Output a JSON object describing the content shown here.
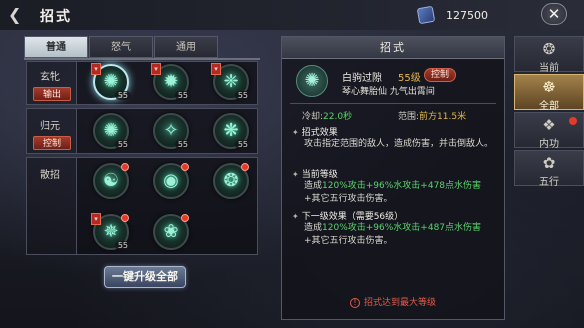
{
  "header": {
    "title": "招式",
    "back_icon": "back-arrow-icon",
    "currency_icon": "book-currency-icon",
    "currency_value": "127500",
    "close_icon": "close-icon"
  },
  "tabs": [
    {
      "label": "普通",
      "active": true
    },
    {
      "label": "怒气",
      "active": false
    },
    {
      "label": "通用",
      "active": false
    }
  ],
  "rows": [
    {
      "label": "玄牝",
      "badge": "输出",
      "skills": [
        {
          "glyph": "✺",
          "level": "55",
          "tagged": true,
          "selected": true
        },
        {
          "glyph": "✹",
          "level": "55",
          "tagged": true
        },
        {
          "glyph": "❈",
          "level": "55",
          "tagged": true
        }
      ]
    },
    {
      "label": "归元",
      "badge": "控制",
      "skills": [
        {
          "glyph": "✺",
          "level": "55"
        },
        {
          "glyph": "✧",
          "level": "55"
        },
        {
          "glyph": "❋",
          "level": "55"
        }
      ]
    },
    {
      "label": "散招",
      "badge": "",
      "skills": [
        {
          "glyph": "☯",
          "dot": true
        },
        {
          "glyph": "◉",
          "dot": true
        },
        {
          "glyph": "❂",
          "dot": true
        },
        {
          "glyph": "✵",
          "level": "55",
          "tagged": true,
          "dot": true
        },
        {
          "glyph": "❀",
          "dot": true
        }
      ]
    }
  ],
  "upgrade_button": "一键升级全部",
  "detail": {
    "header": "招式",
    "icon": "skill-wind-icon",
    "name": "白驹过隙",
    "level": "55级",
    "type": "控制",
    "desc": "琴心舞胎仙 九气出霄间",
    "cd_label": "冷却:",
    "cd_value": "22.0秒",
    "range_label": "范围:",
    "range_value": "前方11.5米",
    "effect_title": "招式效果",
    "effect_text": "攻击指定范围的敌人，造成伤害，并击倒敌人。",
    "cur_title": "当前等级",
    "cur_prefix": "造成",
    "cur_a": "120%攻击",
    "cur_b": "+96%水攻击",
    "cur_c": "+478点水伤害",
    "cur_suffix": "+其它五行攻击伤害。",
    "next_title": "下一级效果（需要56级）",
    "next_prefix": "造成",
    "next_a": "120%攻击",
    "next_b": "+96%水攻击",
    "next_c": "+487点水伤害",
    "next_suffix": "+其它五行攻击伤害。",
    "footer": "招式达到最大等级"
  },
  "sidenav": [
    {
      "label": "当前",
      "icon": "current-icon",
      "glyph": "❂",
      "active": false
    },
    {
      "label": "全部",
      "icon": "all-icon",
      "glyph": "☸",
      "active": true
    },
    {
      "label": "内功",
      "icon": "inner-power-icon",
      "glyph": "❖",
      "active": false,
      "dot": true
    },
    {
      "label": "五行",
      "icon": "five-elements-icon",
      "glyph": "✿",
      "active": false
    }
  ]
}
